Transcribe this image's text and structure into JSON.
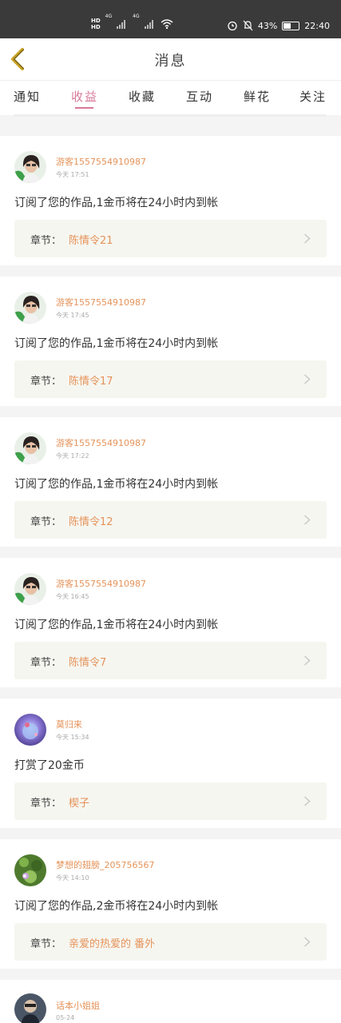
{
  "status": {
    "hd1": "HD",
    "hd2": "HD",
    "net1": "4G",
    "net2": "4G",
    "battery": "43%",
    "time": "22:40"
  },
  "header": {
    "title": "消息"
  },
  "tabs": [
    "通知",
    "收益",
    "收藏",
    "互动",
    "鲜花",
    "关注"
  ],
  "active_tab": "收益",
  "chapter_label": "章节：",
  "messages": [
    {
      "name": "游客1557554910987",
      "time": "今天 17:51",
      "text": "订阅了您的作品,1金币将在24小时内到帐",
      "chapter": "陈情令21"
    },
    {
      "name": "游客1557554910987",
      "time": "今天 17:45",
      "text": "订阅了您的作品,1金币将在24小时内到帐",
      "chapter": "陈情令17"
    },
    {
      "name": "游客1557554910987",
      "time": "今天 17:22",
      "text": "订阅了您的作品,1金币将在24小时内到帐",
      "chapter": "陈情令12"
    },
    {
      "name": "游客1557554910987",
      "time": "今天 16:45",
      "text": "订阅了您的作品,1金币将在24小时内到帐",
      "chapter": "陈情令7"
    },
    {
      "name": "莫归来",
      "time": "今天 15:34",
      "text": "打赏了20金币",
      "chapter": "楔子"
    },
    {
      "name": "梦想的翅膀_205756567",
      "time": "今天 14:10",
      "text": "订阅了您的作品,2金币将在24小时内到帐",
      "chapter": "亲爱的热爱的 番外"
    },
    {
      "name": "话本小姐姐",
      "time": "05-24"
    }
  ],
  "colors": {
    "accent": "#d9789a",
    "name": "#e5935a",
    "statusbar": "#3a3a3a"
  }
}
